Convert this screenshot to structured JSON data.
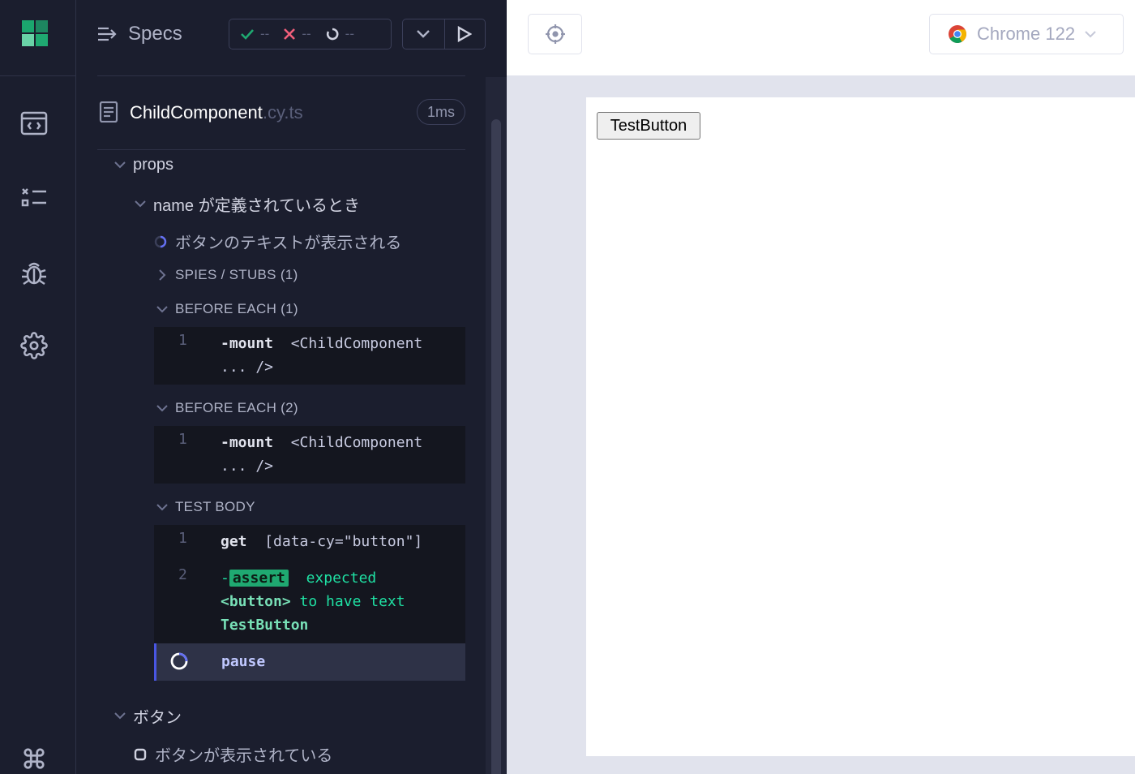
{
  "header": {
    "specs_label": "Specs",
    "passed": "--",
    "failed": "--",
    "pending": "--"
  },
  "file": {
    "name": "ChildComponent",
    "ext": ".cy.ts",
    "duration": "1ms"
  },
  "suite": {
    "props_label": "props",
    "name_context": "name が定義されているとき",
    "test_title": "ボタンのテキストが表示される",
    "spies_label": "SPIES / STUBS (1)",
    "before_each_1": "BEFORE EACH (1)",
    "before_each_2": "BEFORE EACH (2)",
    "test_body": "TEST BODY",
    "button_suite": "ボタン",
    "button_test": "ボタンが表示されている"
  },
  "commands": {
    "be1": {
      "num": "1",
      "name": "-mount",
      "msg": "<ChildComponent ... />"
    },
    "be2": {
      "num": "1",
      "name": "-mount",
      "msg": "<ChildComponent ... />"
    },
    "body1": {
      "num": "1",
      "name": "get",
      "msg": "[data-cy=\"button\"]"
    },
    "body2": {
      "num": "2",
      "dash": "-",
      "badge": "assert",
      "expected": "expected",
      "subject": "<button>",
      "to_have": "to have text",
      "value": "TestButton"
    },
    "pause": {
      "name": "pause"
    }
  },
  "browser": {
    "label": "Chrome 122"
  },
  "aut": {
    "button_label": "TestButton"
  },
  "icons": {
    "logo": "cypress-logo",
    "nav": [
      "specs-icon",
      "runs-icon",
      "debug-icon",
      "settings-icon",
      "keyboard-shortcuts-icon"
    ]
  },
  "colors": {
    "accent_green": "#1fa971",
    "fail_red": "#f15f7b",
    "bg_dark": "#1b1e2e"
  }
}
